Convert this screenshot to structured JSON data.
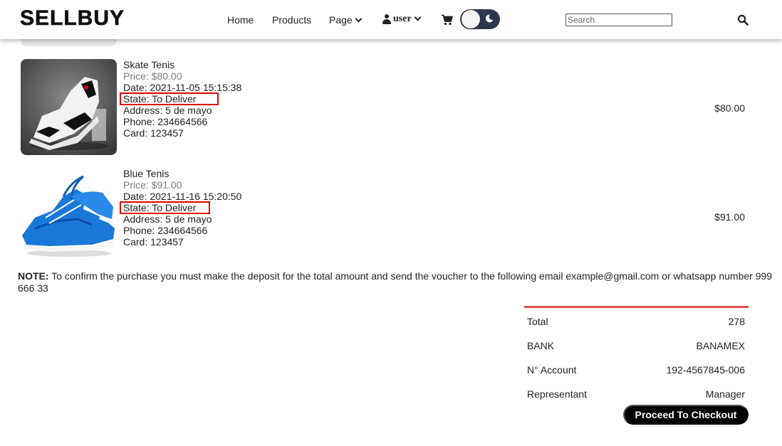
{
  "brand": "SELLBUY",
  "nav": {
    "home": "Home",
    "products": "Products",
    "page": "Page",
    "user": "user"
  },
  "search": {
    "placeholder": "Search"
  },
  "items": [
    {
      "name": "Skate Tenis",
      "price": "Price: $80.00",
      "date": "Date: 2021-11-05 15:15:38",
      "state": "State: To Deliver",
      "address": "Address: 5 de mayo",
      "phone": "Phone: 234664566",
      "card": "Card: 123457",
      "total": "$80.00"
    },
    {
      "name": "Blue Tenis",
      "price": "Price: $91.00",
      "date": "Date: 2021-11-16 15:20:50",
      "state": "State: To Deliver",
      "address": "Address: 5 de mayo",
      "phone": "Phone: 234664566",
      "card": "Card: 123457",
      "total": "$91.00"
    }
  ],
  "note": {
    "label": "NOTE:",
    "text": " To confirm the purchase you must make the deposit for the total amount and send the voucher to the following email example@gmail.com or whatsapp number 999 666 33"
  },
  "summary": {
    "total_label": "Total",
    "total_value": "278",
    "bank_label": "BANK",
    "bank_value": "BANAMEX",
    "account_label": "N° Account",
    "account_value": "192-4567845-006",
    "rep_label": "Representant",
    "rep_value": "Manager"
  },
  "checkout_label": "Proceed To Checkout",
  "colors": {
    "accent_line": "#e05050",
    "highlight_box": "#e00000",
    "toggle_bg": "#2e3550"
  }
}
